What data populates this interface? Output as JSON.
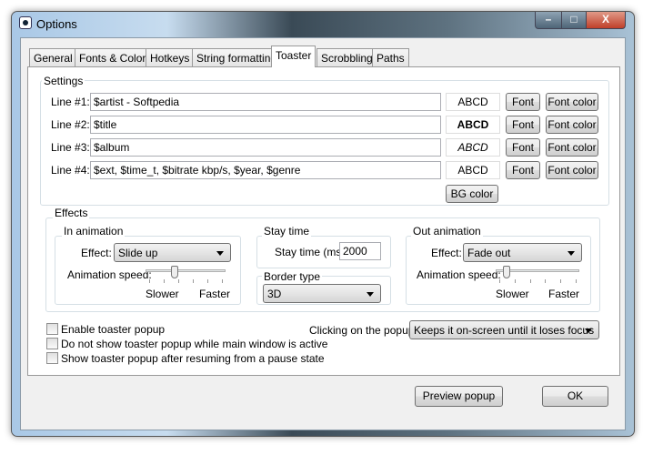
{
  "window": {
    "title": "Options",
    "minimize": "–",
    "maximize": "□",
    "close": "X"
  },
  "tabs": [
    "General",
    "Fonts & Colors",
    "Hotkeys",
    "String formatting",
    "Toaster",
    "Scrobbling",
    "Paths"
  ],
  "active_tab": "Toaster",
  "settings": {
    "label": "Settings",
    "lines": [
      {
        "label": "Line #1:",
        "value": "$artist - Softpedia",
        "preview": "ABCD",
        "font": "Font",
        "font_color": "Font color"
      },
      {
        "label": "Line #2:",
        "value": "$title",
        "preview": "ABCD",
        "font": "Font",
        "font_color": "Font color"
      },
      {
        "label": "Line #3:",
        "value": "$album",
        "preview": "ABCD",
        "font": "Font",
        "font_color": "Font color"
      },
      {
        "label": "Line #4:",
        "value": "$ext, $time_t, $bitrate kbp/s, $year, $genre",
        "preview": "ABCD",
        "font": "Font",
        "font_color": "Font color"
      }
    ],
    "bg_color": "BG color"
  },
  "effects": {
    "label": "Effects",
    "in": {
      "label": "In animation",
      "effect_label": "Effect:",
      "effect": "Slide up",
      "speed_label": "Animation speed:",
      "slower": "Slower",
      "faster": "Faster",
      "speed_fraction": 0.35
    },
    "stay": {
      "label": "Stay time",
      "field_label": "Stay time (ms):",
      "value": "2000"
    },
    "border": {
      "label": "Border type",
      "value": "3D"
    },
    "out": {
      "label": "Out animation",
      "effect_label": "Effect:",
      "effect": "Fade out",
      "speed_label": "Animation speed:",
      "slower": "Slower",
      "faster": "Faster",
      "speed_fraction": 0.1
    }
  },
  "options": [
    {
      "label": "Enable toaster popup",
      "checked": false
    },
    {
      "label": "Do not show toaster popup while main window is active",
      "checked": false
    },
    {
      "label": "Show toaster popup after resuming from a pause state",
      "checked": false
    }
  ],
  "click": {
    "label": "Clicking on the popup:",
    "value": "Keeps it on-screen until it loses focus"
  },
  "buttons": {
    "preview": "Preview popup",
    "ok": "OK"
  }
}
